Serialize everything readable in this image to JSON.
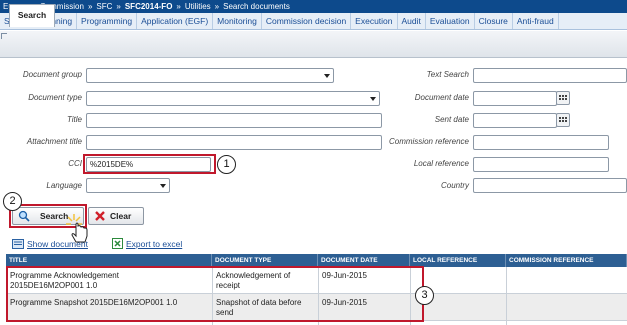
{
  "topbar": {
    "items": [
      "European Commission",
      "SFC",
      "SFC2014-FO",
      "Utilities",
      "Search documents"
    ],
    "separator": "»"
  },
  "menu": {
    "items": [
      "Strategic planning",
      "Programming",
      "Application (EGF)",
      "Monitoring",
      "Commission decision",
      "Execution",
      "Audit",
      "Evaluation",
      "Closure",
      "Anti-fraud"
    ]
  },
  "tabs": {
    "search_label": "Search"
  },
  "form": {
    "document_group_label": "Document group",
    "document_type_label": "Document type",
    "title_label": "Title",
    "attachment_title_label": "Attachment title",
    "cci_label": "CCI",
    "cci_value": "%2015DE%",
    "language_label": "Language",
    "text_search_label": "Text Search",
    "document_date_label": "Document date",
    "sent_date_label": "Sent date",
    "commission_reference_label": "Commission reference",
    "local_reference_label": "Local reference",
    "country_label": "Country"
  },
  "buttons": {
    "search_label": "Search",
    "clear_label": "Clear"
  },
  "links": {
    "show_document": "Show document",
    "export_excel": "Export to excel"
  },
  "callouts": {
    "one": "1",
    "two": "2",
    "three": "3"
  },
  "table": {
    "headers": [
      "TITLE",
      "DOCUMENT TYPE",
      "DOCUMENT DATE",
      "LOCAL REFERENCE",
      "COMMISSION REFERENCE"
    ],
    "rows": [
      {
        "title_line1": "Programme Acknowledgement",
        "title_line2": "2015DE16M2OP001 1.0",
        "type_line1": "Acknowledgement of",
        "type_line2": "receipt",
        "date": "09-Jun-2015"
      },
      {
        "title_line1": "Programme Snapshot 2015DE16M2OP001 1.0",
        "title_line2": "",
        "type_line1": "Snapshot of data before",
        "type_line2": "send",
        "date": "09-Jun-2015"
      }
    ]
  },
  "colors": {
    "header_blue": "#2d5f93",
    "callout_red": "#c0182c",
    "topbar": "#0d4a8c"
  }
}
